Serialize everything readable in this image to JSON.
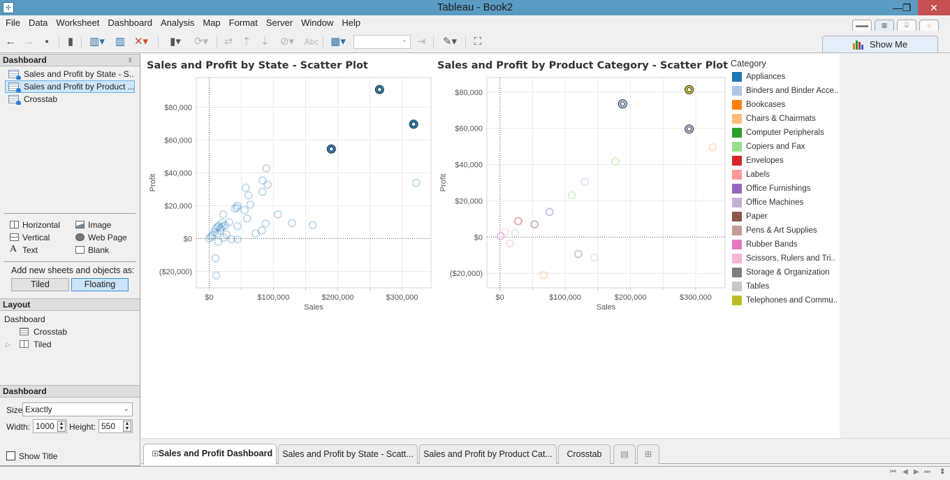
{
  "window": {
    "title": "Tableau - Book2",
    "controls": {
      "minimize": "—",
      "restore": "❐",
      "close": "✕"
    }
  },
  "menu": [
    "File",
    "Data",
    "Worksheet",
    "Dashboard",
    "Analysis",
    "Map",
    "Format",
    "Server",
    "Window",
    "Help"
  ],
  "toolbar": {
    "icons": [
      "back-icon",
      "forward-icon",
      "save-icon",
      "datasource-icon",
      "new-worksheet-icon",
      "duplicate-sheet-icon",
      "clear-sheet-icon",
      "pause-updates-icon",
      "refresh-icon",
      "swap-icon",
      "sort-ascending-icon",
      "sort-descending-icon",
      "attach-icon",
      "label-icon",
      "chart-type-icon",
      "fit-select",
      "fix-axes-icon",
      "highlight-icon",
      "presentation-icon"
    ],
    "label_text": "Abc",
    "fit_value": ""
  },
  "show_me": {
    "label": "Show Me"
  },
  "sidebar": {
    "dashboard_header": "Dashboard",
    "sheets": [
      {
        "label": "Sales and Profit by State - S...",
        "selected": false
      },
      {
        "label": "Sales and Profit by Product ...",
        "selected": true
      },
      {
        "label": "Crosstab",
        "selected": false
      }
    ],
    "objects": [
      {
        "label": "Horizontal",
        "icon": "horizontal-container-icon"
      },
      {
        "label": "Image",
        "icon": "image-icon"
      },
      {
        "label": "Vertical",
        "icon": "vertical-container-icon"
      },
      {
        "label": "Web Page",
        "icon": "web-page-icon"
      },
      {
        "label": "Text",
        "icon": "text-icon"
      },
      {
        "label": "Blank",
        "icon": "blank-icon"
      }
    ],
    "add_as_label": "Add new sheets and objects as:",
    "tiled_label": "Tiled",
    "floating_label": "Floating",
    "floating_active": true,
    "layout_header": "Layout",
    "layout_tree": {
      "root": "Dashboard",
      "items": [
        "Crosstab",
        "Tiled"
      ]
    },
    "size_header": "Dashboard",
    "size_label": "Size:",
    "size_value": "Exactly",
    "width_label": "Width:",
    "width_value": "1000",
    "height_label": "Height:",
    "height_value": "550",
    "show_title_label": "Show Title",
    "show_title_checked": false
  },
  "legend": {
    "title": "Category",
    "items": [
      {
        "label": "Appliances",
        "color": "#1f77b4"
      },
      {
        "label": "Binders and Binder Acce..",
        "color": "#aec7e8"
      },
      {
        "label": "Bookcases",
        "color": "#ff7f0e"
      },
      {
        "label": "Chairs & Chairmats",
        "color": "#ffbb78"
      },
      {
        "label": "Computer Peripherals",
        "color": "#2ca02c"
      },
      {
        "label": "Copiers and Fax",
        "color": "#98df8a"
      },
      {
        "label": "Envelopes",
        "color": "#d62728"
      },
      {
        "label": "Labels",
        "color": "#ff9896"
      },
      {
        "label": "Office Furnishings",
        "color": "#9467bd"
      },
      {
        "label": "Office Machines",
        "color": "#c5b0d5"
      },
      {
        "label": "Paper",
        "color": "#8c564b"
      },
      {
        "label": "Pens & Art Supplies",
        "color": "#c49c94"
      },
      {
        "label": "Rubber Bands",
        "color": "#e377c2"
      },
      {
        "label": "Scissors, Rulers and Tri..",
        "color": "#f7b6d2"
      },
      {
        "label": "Storage & Organization",
        "color": "#7f7f7f"
      },
      {
        "label": "Tables",
        "color": "#c7c7c7"
      },
      {
        "label": "Telephones and Commu..",
        "color": "#bcbd22"
      }
    ]
  },
  "chart_data": [
    {
      "type": "scatter",
      "title": "Sales and Profit by State - Scatter Plot",
      "xlabel": "Sales",
      "ylabel": "Profit",
      "xlim": [
        -20000,
        345000
      ],
      "ylim": [
        -30000,
        98000
      ],
      "xticks": [
        {
          "v": 0,
          "label": "$0"
        },
        {
          "v": 100000,
          "label": "$100,000"
        },
        {
          "v": 200000,
          "label": "$200,000"
        },
        {
          "v": 300000,
          "label": "$300,000"
        }
      ],
      "yticks": [
        {
          "v": -20000,
          "label": "($20,000)"
        },
        {
          "v": 0,
          "label": "$0"
        },
        {
          "v": 20000,
          "label": "$20,000"
        },
        {
          "v": 40000,
          "label": "$40,000"
        },
        {
          "v": 60000,
          "label": "$60,000"
        },
        {
          "v": 80000,
          "label": "$80,000"
        }
      ],
      "grid": true,
      "mark_color": "#1f77b4",
      "points": [
        {
          "x": 265000,
          "y": 90700,
          "highlight": true
        },
        {
          "x": 318000,
          "y": 69600,
          "highlight": true
        },
        {
          "x": 190000,
          "y": 54500,
          "highlight": true
        },
        {
          "x": 322000,
          "y": 34000
        },
        {
          "x": 89000,
          "y": 42700
        },
        {
          "x": 83000,
          "y": 35400
        },
        {
          "x": 91000,
          "y": 32800
        },
        {
          "x": 83000,
          "y": 28400
        },
        {
          "x": 57000,
          "y": 30900
        },
        {
          "x": 61000,
          "y": 26300
        },
        {
          "x": 64000,
          "y": 20700
        },
        {
          "x": 44000,
          "y": 20000
        },
        {
          "x": 43000,
          "y": 18800
        },
        {
          "x": 40000,
          "y": 18200
        },
        {
          "x": 55000,
          "y": 17300
        },
        {
          "x": 22000,
          "y": 14700
        },
        {
          "x": 107000,
          "y": 14700
        },
        {
          "x": 59000,
          "y": 12200
        },
        {
          "x": 129000,
          "y": 9400
        },
        {
          "x": 161000,
          "y": 8200
        },
        {
          "x": 88000,
          "y": 9100
        },
        {
          "x": 31000,
          "y": 10000
        },
        {
          "x": 44000,
          "y": 7600
        },
        {
          "x": 20000,
          "y": 9500
        },
        {
          "x": 25000,
          "y": 8000
        },
        {
          "x": 13000,
          "y": 7000
        },
        {
          "x": 10000,
          "y": 6000
        },
        {
          "x": 17000,
          "y": 5000
        },
        {
          "x": 15000,
          "y": 7800
        },
        {
          "x": 82000,
          "y": 4900
        },
        {
          "x": 72000,
          "y": 3100
        },
        {
          "x": 27000,
          "y": 2500
        },
        {
          "x": 5000,
          "y": 2000
        },
        {
          "x": 3000,
          "y": 1000
        },
        {
          "x": 0,
          "y": 0
        },
        {
          "x": 23000,
          "y": 500
        },
        {
          "x": 35000,
          "y": -500
        },
        {
          "x": 44000,
          "y": -500
        },
        {
          "x": 14000,
          "y": -2000
        },
        {
          "x": 10000,
          "y": -12000
        },
        {
          "x": 11000,
          "y": -22500
        },
        {
          "x": 8000,
          "y": 4000
        },
        {
          "x": 12000,
          "y": 3000
        },
        {
          "x": 18000,
          "y": 6500
        },
        {
          "x": 21000,
          "y": 7200
        }
      ]
    },
    {
      "type": "scatter",
      "title": "Sales and Profit by Product Category - Scatter Plot",
      "xlabel": "Sales",
      "ylabel": "Profit",
      "xlim": [
        -20000,
        345000
      ],
      "ylim": [
        -28000,
        88000
      ],
      "xticks": [
        {
          "v": 0,
          "label": "$0"
        },
        {
          "v": 100000,
          "label": "$100,000"
        },
        {
          "v": 200000,
          "label": "$200,000"
        },
        {
          "v": 300000,
          "label": "$300,000"
        }
      ],
      "yticks": [
        {
          "v": -20000,
          "label": "($20,000)"
        },
        {
          "v": 0,
          "label": "$0"
        },
        {
          "v": 20000,
          "label": "$20,000"
        },
        {
          "v": 40000,
          "label": "$40,000"
        },
        {
          "v": 60000,
          "label": "$60,000"
        },
        {
          "v": 80000,
          "label": "$80,000"
        }
      ],
      "grid": true,
      "legend": "right",
      "points": [
        {
          "x": 290000,
          "y": 81300,
          "category": "Telephones and Commu..",
          "highlight": true
        },
        {
          "x": 188000,
          "y": 73500,
          "category": "Binders and Binder Acce..",
          "highlight": true
        },
        {
          "x": 290000,
          "y": 59600,
          "category": "Office Machines",
          "highlight": true
        },
        {
          "x": 326000,
          "y": 49500,
          "category": "Chairs & Chairmats"
        },
        {
          "x": 177000,
          "y": 41700,
          "category": "Copiers and Fax"
        },
        {
          "x": 130000,
          "y": 30500,
          "category": "Binders and Binder Acce.."
        },
        {
          "x": 110000,
          "y": 23200,
          "category": "Copiers and Fax"
        },
        {
          "x": 76000,
          "y": 13900,
          "category": "Office Furnishings"
        },
        {
          "x": 28000,
          "y": 8800,
          "category": "Envelopes"
        },
        {
          "x": 53000,
          "y": 7000,
          "category": "Paper"
        },
        {
          "x": 8000,
          "y": 3000,
          "category": "Scissors, Rulers and Tri.."
        },
        {
          "x": 23000,
          "y": 2400,
          "category": "Tables"
        },
        {
          "x": 1000,
          "y": 500,
          "category": "Rubber Bands"
        },
        {
          "x": 15000,
          "y": -3500,
          "category": "Scissors, Rulers and Tri.."
        },
        {
          "x": 120000,
          "y": -9300,
          "category": "Storage & Organization"
        },
        {
          "x": 145000,
          "y": -11300,
          "category": "Tables"
        },
        {
          "x": 67000,
          "y": -21000,
          "category": "Chairs & Chairmats"
        }
      ]
    }
  ],
  "tabs": [
    {
      "label": "Sales and Profit Dashboard",
      "active": true
    },
    {
      "label": "Sales and Profit by State - Scatt...",
      "active": false
    },
    {
      "label": "Sales and Profit by Product Cat...",
      "active": false
    },
    {
      "label": "Crosstab",
      "active": false
    }
  ]
}
